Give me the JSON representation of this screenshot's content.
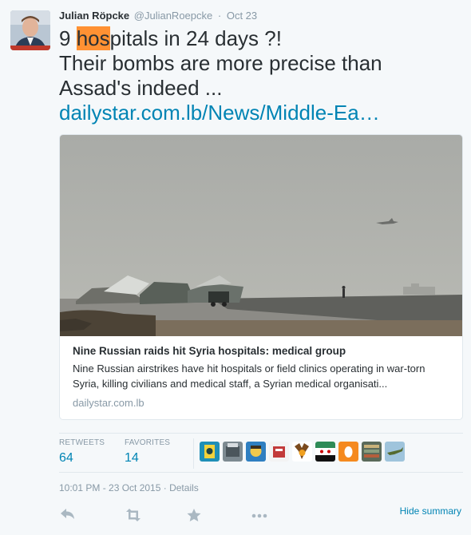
{
  "tweet": {
    "fullname": "Julian Röpcke",
    "username": "@JulianRoepcke",
    "separator": "·",
    "date": "Oct 23",
    "text_prefix": "9 ",
    "text_highlight": "hos",
    "text_rest": "pitals in 24 days ?!",
    "text_line2": "Their bombs are more precise than",
    "text_line3": "Assad's indeed ...",
    "link": "dailystar.com.lb/News/Middle-Ea…"
  },
  "card": {
    "title": "Nine Russian raids hit Syria hospitals: medical group",
    "description": "Nine Russian airstrikes have hit hospitals or field clinics operating in war-torn Syria, killing civilians and medical staff, a Syrian medical organisati...",
    "domain": "dailystar.com.lb"
  },
  "stats": {
    "retweets_label": "RETWEETS",
    "retweets_count": "64",
    "favorites_label": "FAVORITES",
    "favorites_count": "14"
  },
  "meta": {
    "timestamp": "10:01 PM - 23 Oct 2015",
    "separator": "·",
    "details": "Details"
  },
  "actions": {
    "reply_icon": "reply-icon",
    "retweet_icon": "retweet-icon",
    "favorite_icon": "star-icon",
    "more_icon": "more-icon",
    "hide_summary": "Hide summary"
  },
  "colors": {
    "link": "#0084b4",
    "highlight": "#ff9133",
    "muted": "#8899a6",
    "border": "#e1e8ed"
  }
}
